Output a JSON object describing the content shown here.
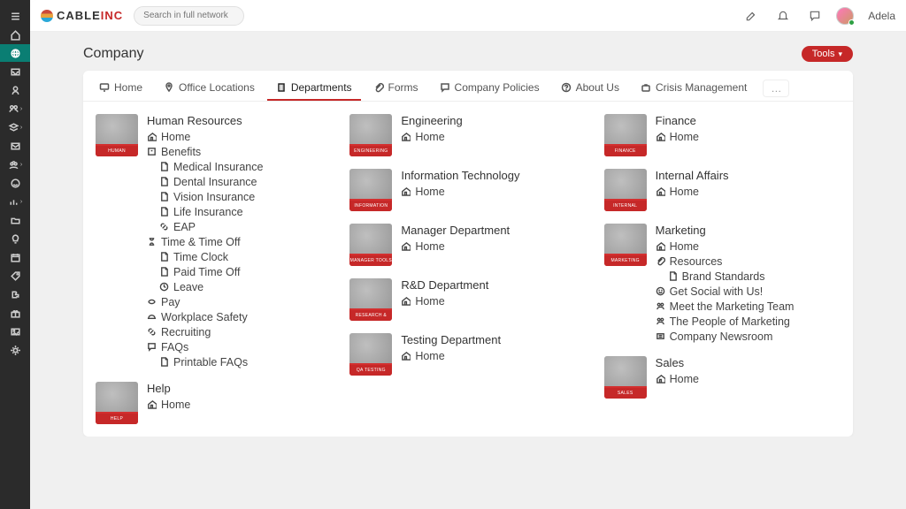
{
  "brand": {
    "cable": "CABLE",
    "inc": "INC"
  },
  "search": {
    "placeholder": "Search in full network"
  },
  "user": {
    "name": "Adela"
  },
  "page": {
    "title": "Company",
    "tools_label": "Tools"
  },
  "tabs": [
    {
      "label": "Home",
      "icon": "monitor",
      "active": false
    },
    {
      "label": "Office Locations",
      "icon": "pin",
      "active": false
    },
    {
      "label": "Departments",
      "icon": "building",
      "active": true
    },
    {
      "label": "Forms",
      "icon": "clip",
      "active": false
    },
    {
      "label": "Company Policies",
      "icon": "chat",
      "active": false
    },
    {
      "label": "About Us",
      "icon": "help",
      "active": false
    },
    {
      "label": "Crisis Management",
      "icon": "case",
      "active": false
    }
  ],
  "columns": [
    [
      {
        "title": "Human Resources",
        "thumb": "HUMAN RESOURCES",
        "items": [
          {
            "icon": "home",
            "label": "Home",
            "indent": 0
          },
          {
            "icon": "badge",
            "label": "Benefits",
            "indent": 0
          },
          {
            "icon": "doc",
            "label": "Medical Insurance",
            "indent": 1
          },
          {
            "icon": "doc",
            "label": "Dental Insurance",
            "indent": 1
          },
          {
            "icon": "doc",
            "label": "Vision Insurance",
            "indent": 1
          },
          {
            "icon": "doc",
            "label": "Life Insurance",
            "indent": 1
          },
          {
            "icon": "link",
            "label": "EAP",
            "indent": 1
          },
          {
            "icon": "hourglass",
            "label": "Time & Time Off",
            "indent": 0
          },
          {
            "icon": "doc",
            "label": "Time Clock",
            "indent": 1
          },
          {
            "icon": "doc",
            "label": "Paid Time Off",
            "indent": 1
          },
          {
            "icon": "clock",
            "label": "Leave",
            "indent": 1
          },
          {
            "icon": "money",
            "label": "Pay",
            "indent": 0
          },
          {
            "icon": "hardhat",
            "label": "Workplace Safety",
            "indent": 0
          },
          {
            "icon": "link",
            "label": "Recruiting",
            "indent": 0
          },
          {
            "icon": "chat",
            "label": "FAQs",
            "indent": 0
          },
          {
            "icon": "doc",
            "label": "Printable FAQs",
            "indent": 1
          }
        ]
      },
      {
        "title": "Help",
        "thumb": "HELP",
        "items": [
          {
            "icon": "home",
            "label": "Home",
            "indent": 0
          }
        ]
      }
    ],
    [
      {
        "title": "Engineering",
        "thumb": "ENGINEERING",
        "items": [
          {
            "icon": "home",
            "label": "Home",
            "indent": 0
          }
        ]
      },
      {
        "title": "Information Technology",
        "thumb": "INFORMATION TECHNOLOGY",
        "items": [
          {
            "icon": "home",
            "label": "Home",
            "indent": 0
          }
        ]
      },
      {
        "title": "Manager Department",
        "thumb": "MANAGER TOOLS",
        "items": [
          {
            "icon": "home",
            "label": "Home",
            "indent": 0
          }
        ]
      },
      {
        "title": "R&D Department",
        "thumb": "RESEARCH & DEVELOPMENT",
        "items": [
          {
            "icon": "home",
            "label": "Home",
            "indent": 0
          }
        ]
      },
      {
        "title": "Testing Department",
        "thumb": "QA TESTING",
        "items": [
          {
            "icon": "home",
            "label": "Home",
            "indent": 0
          }
        ]
      }
    ],
    [
      {
        "title": "Finance",
        "thumb": "FINANCE",
        "items": [
          {
            "icon": "home",
            "label": "Home",
            "indent": 0
          }
        ]
      },
      {
        "title": "Internal Affairs",
        "thumb": "INTERNAL AFFAIRS",
        "items": [
          {
            "icon": "home",
            "label": "Home",
            "indent": 0
          }
        ]
      },
      {
        "title": "Marketing",
        "thumb": "MARKETING",
        "items": [
          {
            "icon": "home",
            "label": "Home",
            "indent": 0
          },
          {
            "icon": "clip",
            "label": "Resources",
            "indent": 0
          },
          {
            "icon": "doc",
            "label": "Brand Standards",
            "indent": 1
          },
          {
            "icon": "smile",
            "label": "Get Social with Us!",
            "indent": 0
          },
          {
            "icon": "team",
            "label": "Meet the Marketing Team",
            "indent": 0
          },
          {
            "icon": "team",
            "label": "The People of Marketing",
            "indent": 0
          },
          {
            "icon": "news",
            "label": "Company Newsroom",
            "indent": 0
          }
        ]
      },
      {
        "title": "Sales",
        "thumb": "SALES",
        "items": [
          {
            "icon": "home",
            "label": "Home",
            "indent": 0
          }
        ]
      }
    ]
  ],
  "leftnav": [
    {
      "name": "hamburger-icon"
    },
    {
      "name": "home-icon"
    },
    {
      "name": "globe-icon",
      "active": true
    },
    {
      "name": "inbox-icon"
    },
    {
      "name": "person-icon"
    },
    {
      "name": "people-icon",
      "chev": true
    },
    {
      "name": "layers-icon",
      "chev": true
    },
    {
      "name": "mail-icon"
    },
    {
      "name": "group-icon",
      "chev": true
    },
    {
      "name": "smile-icon"
    },
    {
      "name": "chart-icon",
      "chev": true
    },
    {
      "name": "folder-icon"
    },
    {
      "name": "bulb-icon"
    },
    {
      "name": "calendar-icon"
    },
    {
      "name": "tag-icon"
    },
    {
      "name": "puzzle-icon"
    },
    {
      "name": "gift-icon"
    },
    {
      "name": "image-icon"
    },
    {
      "name": "gear-icon"
    }
  ]
}
